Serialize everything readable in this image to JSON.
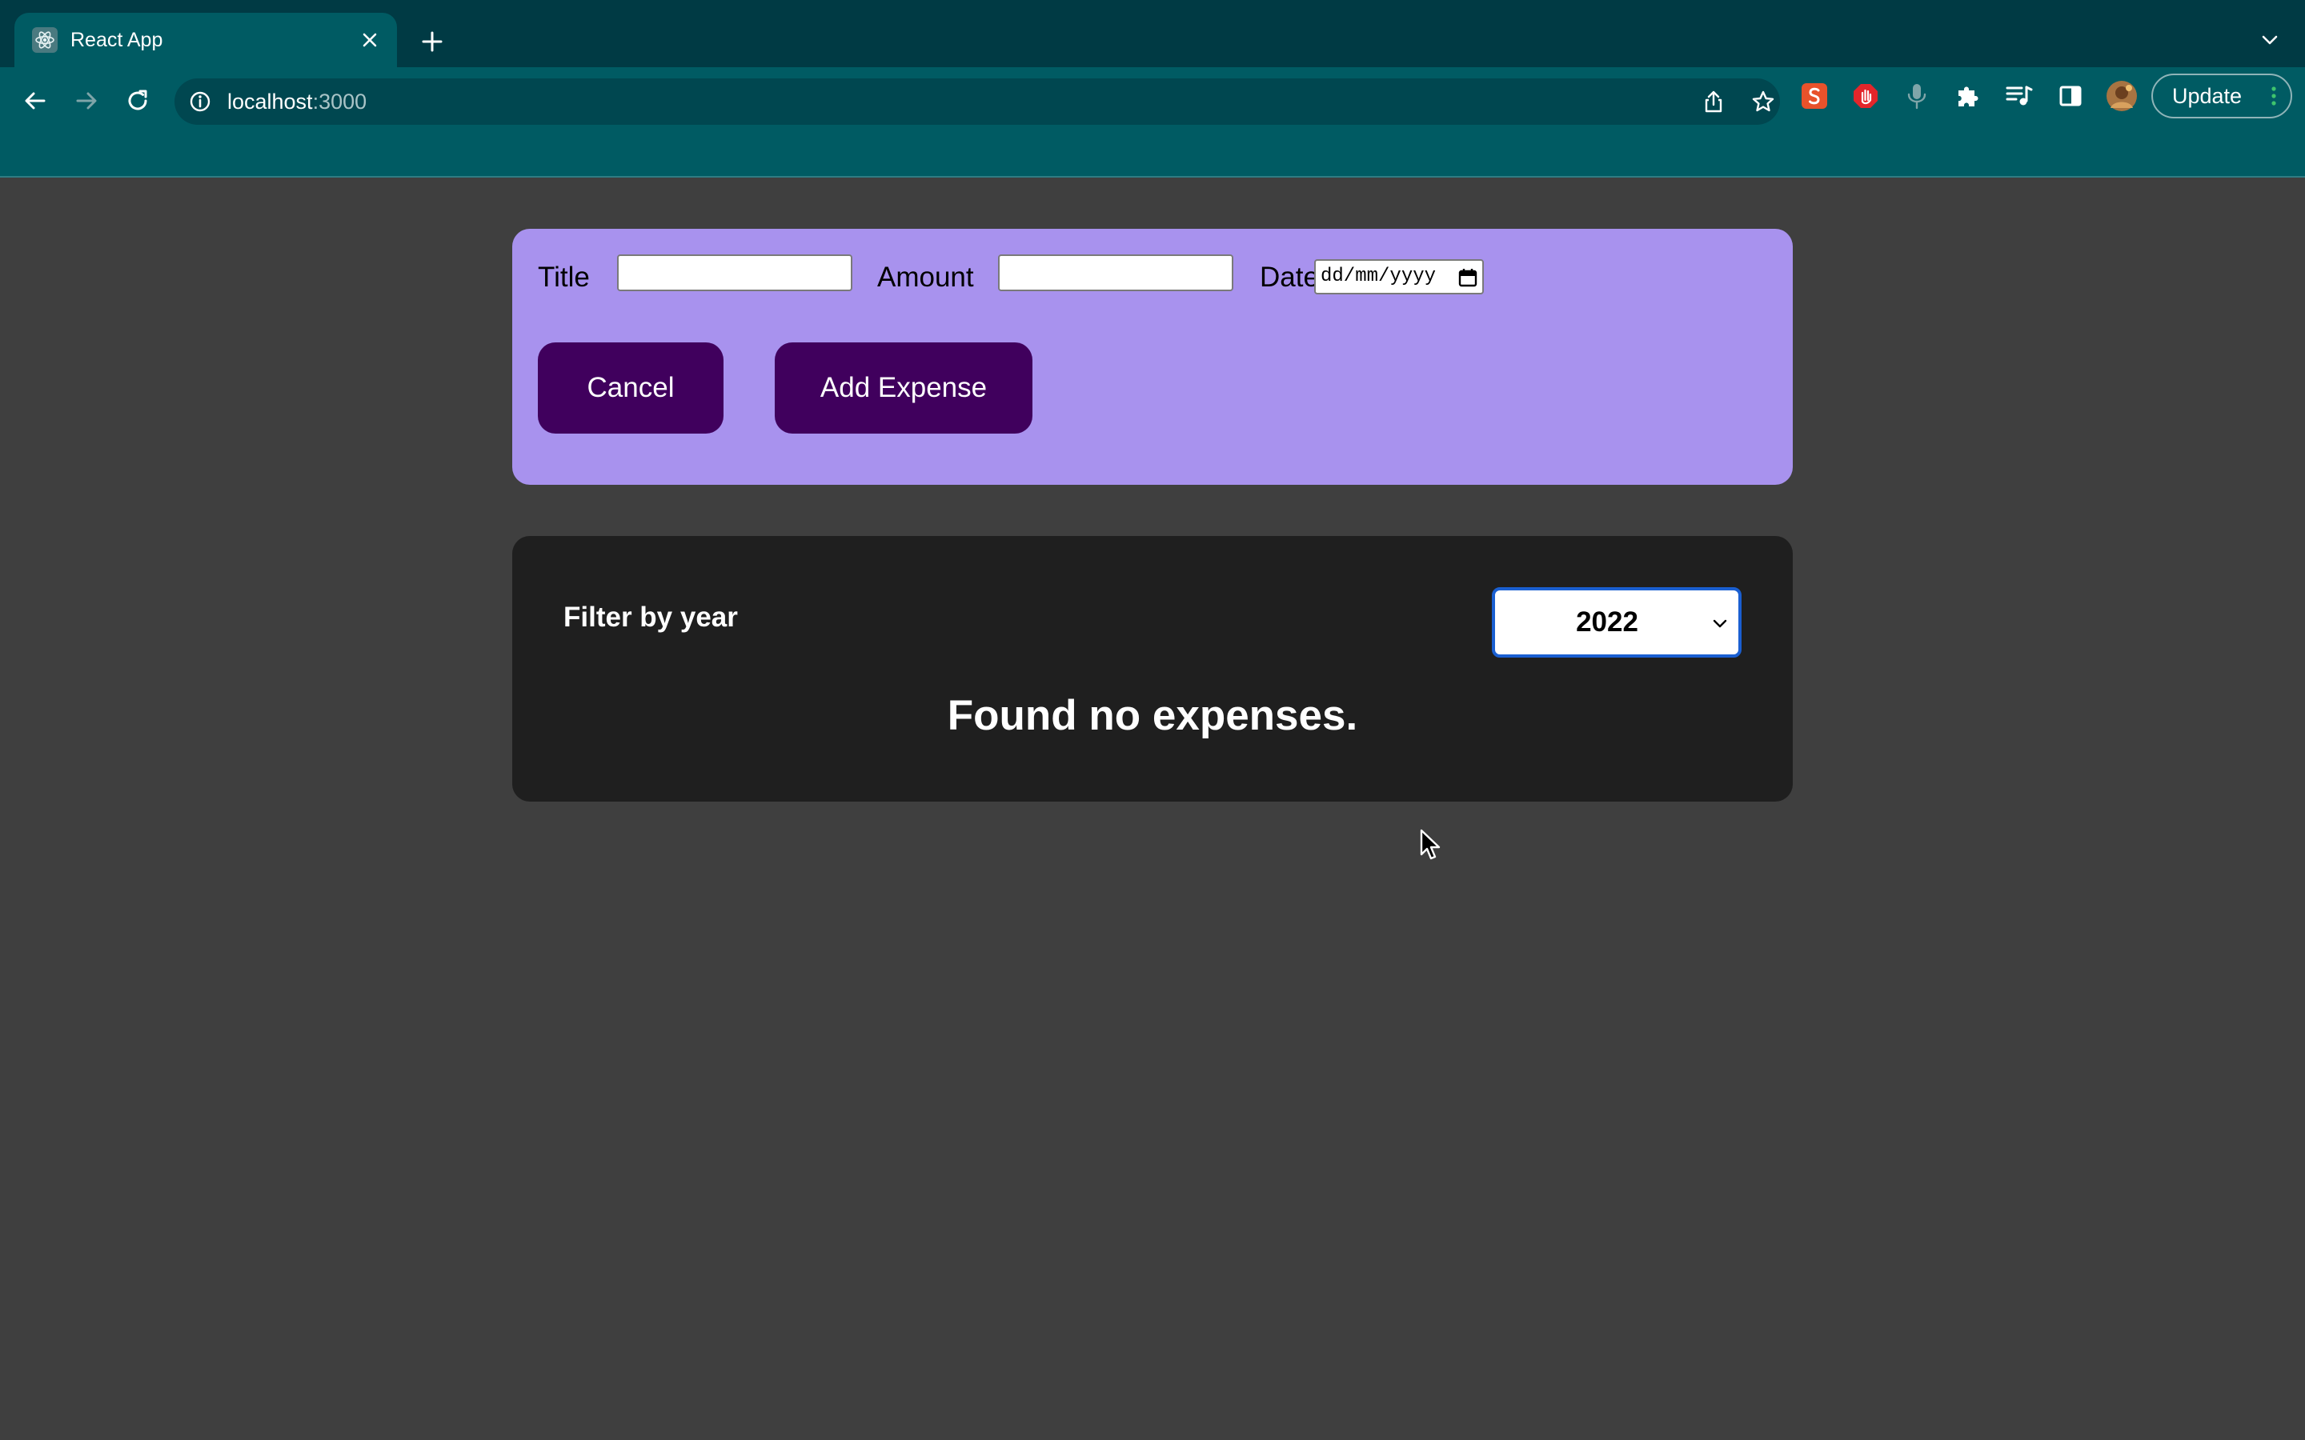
{
  "browser": {
    "tab_title": "React App",
    "url_host": "localhost",
    "url_port": ":3000",
    "update_label": "Update",
    "icons": [
      "react-favicon",
      "close-icon",
      "plus-icon",
      "chevron-down-icon",
      "back-icon",
      "forward-icon",
      "reload-icon",
      "info-icon",
      "share-icon",
      "star-icon",
      "smallpdf-extension-icon",
      "adblock-extension-icon",
      "microphone-icon",
      "puzzle-extensions-icon",
      "media-controls-icon",
      "side-panel-icon",
      "profile-avatar",
      "kebab-menu-icon"
    ]
  },
  "form": {
    "title_label": "Title",
    "title_value": "",
    "amount_label": "Amount",
    "amount_value": "",
    "date_label": "Date",
    "date_placeholder": "dd/mm/yyyy",
    "cancel_label": "Cancel",
    "submit_label": "Add Expense"
  },
  "expenses": {
    "filter_label": "Filter by year",
    "selected_year": "2022",
    "empty_message": "Found no expenses."
  },
  "colors": {
    "form_background": "#a892ee",
    "button_background": "#40005d",
    "panel_background": "#1f1f1f",
    "page_background": "#3f3f3f",
    "chrome_toolbar": "#005b63"
  }
}
